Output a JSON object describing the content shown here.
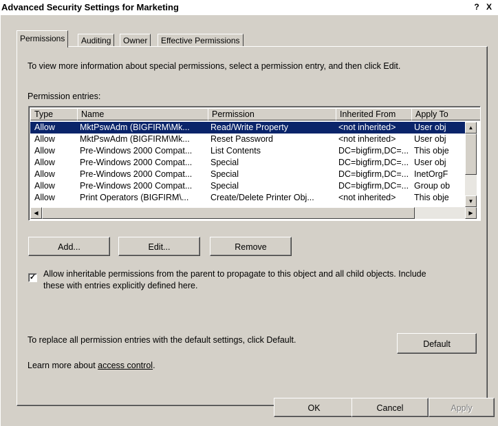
{
  "window": {
    "title": "Advanced Security Settings for Marketing",
    "help_label": "?",
    "close_label": "X"
  },
  "tabs": [
    {
      "label": "Permissions",
      "active": true
    },
    {
      "label": "Auditing",
      "active": false
    },
    {
      "label": "Owner",
      "active": false
    },
    {
      "label": "Effective Permissions",
      "active": false
    }
  ],
  "intro_text": "To view more information about special permissions, select a permission entry, and then click Edit.",
  "entries_label": "Permission entries:",
  "table": {
    "columns": [
      "Type",
      "Name",
      "Permission",
      "Inherited From",
      "Apply To"
    ],
    "rows": [
      {
        "type": "Allow",
        "name": "MktPswAdm (BIGFIRM\\Mk...",
        "permission": "Read/Write Property",
        "inherited": "<not inherited>",
        "apply": "User obj",
        "selected": true
      },
      {
        "type": "Allow",
        "name": "MktPswAdm (BIGFIRM\\Mk...",
        "permission": "Reset Password",
        "inherited": "<not inherited>",
        "apply": "User obj",
        "selected": false
      },
      {
        "type": "Allow",
        "name": "Pre-Windows 2000 Compat...",
        "permission": "List Contents",
        "inherited": "DC=bigfirm,DC=...",
        "apply": "This obje",
        "selected": false
      },
      {
        "type": "Allow",
        "name": "Pre-Windows 2000 Compat...",
        "permission": "Special",
        "inherited": "DC=bigfirm,DC=...",
        "apply": "User obj",
        "selected": false
      },
      {
        "type": "Allow",
        "name": "Pre-Windows 2000 Compat...",
        "permission": "Special",
        "inherited": "DC=bigfirm,DC=...",
        "apply": "InetOrgF",
        "selected": false
      },
      {
        "type": "Allow",
        "name": "Pre-Windows 2000 Compat...",
        "permission": "Special",
        "inherited": "DC=bigfirm,DC=...",
        "apply": "Group ob",
        "selected": false
      },
      {
        "type": "Allow",
        "name": "Print Operators (BIGFIRM\\...",
        "permission": "Create/Delete Printer Obj...",
        "inherited": "<not inherited>",
        "apply": "This obje",
        "selected": false
      }
    ]
  },
  "buttons": {
    "add": "Add...",
    "edit": "Edit...",
    "remove": "Remove",
    "default": "Default",
    "ok": "OK",
    "cancel": "Cancel",
    "apply": "Apply"
  },
  "inherit_checkbox": {
    "checked": true,
    "line1": "Allow inheritable permissions from the parent to propagate to this object and all child objects. Include",
    "line2": "these with entries explicitly defined here."
  },
  "default_text": "To replace all permission entries with the default settings, click Default.",
  "learn_more": {
    "prefix": "Learn more about ",
    "link": "access control",
    "suffix": "."
  }
}
